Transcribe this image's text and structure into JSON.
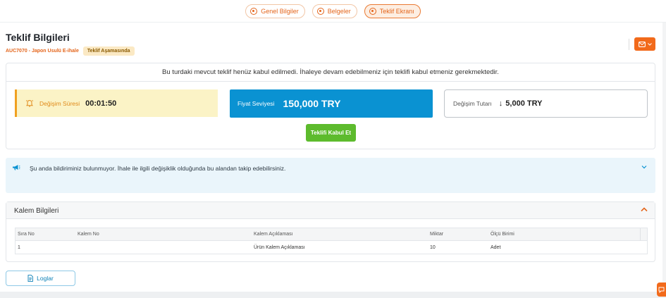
{
  "steps": [
    {
      "label": "Genel Bilgiler",
      "active": false
    },
    {
      "label": "Belgeler",
      "active": false
    },
    {
      "label": "Teklif Ekranı",
      "active": true
    }
  ],
  "header": {
    "title": "Teklif Bilgileri",
    "auction_code": "AUC7070 - Japon Usulü E-ihale",
    "status_badge": "Teklif Aşamasında"
  },
  "offer": {
    "notice": "Bu turdaki mevcut teklif henüz kabul edilmedi. İhaleye devam edebilmeniz için teklifi kabul etmeniz gerekmektedir.",
    "timer_label": "Değişim Süresi",
    "timer_value": "00:01:50",
    "price_label": "Fiyat Seviyesi",
    "price_value": "150,000 TRY",
    "change_label": "Değişim Tutarı",
    "change_arrow": "↓",
    "change_value": "5,000 TRY",
    "accept_button": "Teklifi Kabul Et"
  },
  "notification": {
    "text": "Şu anda bildiriminiz bulunmuyor. İhale ile ilgili değişiklik olduğunda bu alandan takip edebilirsiniz."
  },
  "items": {
    "title": "Kalem Bilgileri",
    "columns": [
      "Sıra No",
      "Kalem No",
      "Kalem Açıklaması",
      "Miktar",
      "Ölçü Birimi"
    ],
    "rows": [
      [
        "1",
        "",
        "Ürün Kalem Açıklaması",
        "10",
        "Adet"
      ]
    ]
  },
  "logs_button": "Loglar",
  "colors": {
    "accent": "#f26a1b",
    "price_bg": "#0a92d2",
    "accept_bg": "#5dbb2d",
    "timer_bg": "#fbf3c6"
  }
}
